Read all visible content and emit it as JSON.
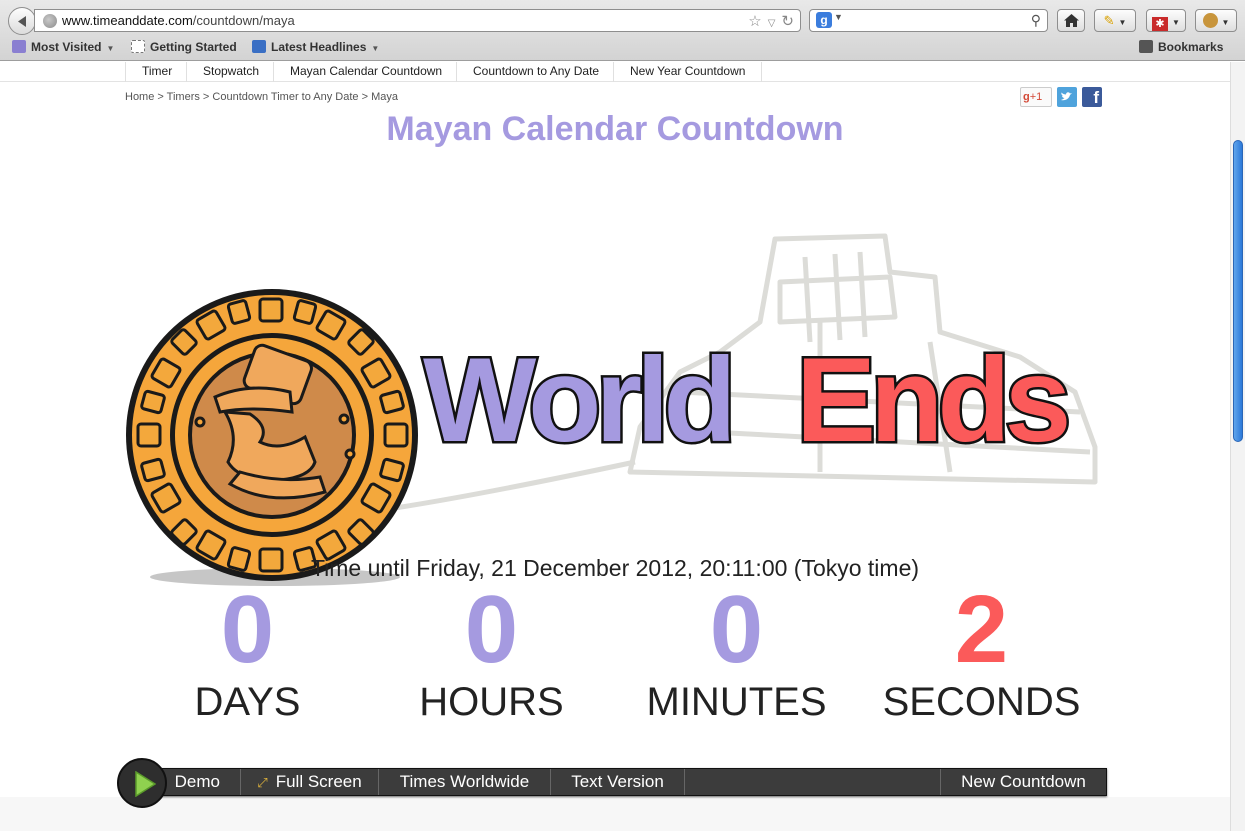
{
  "browser": {
    "url_host": "www.timeanddate.com",
    "url_path": "/countdown/maya",
    "bookmarks": [
      {
        "label": "Most Visited",
        "has_menu": true
      },
      {
        "label": "Getting Started",
        "has_menu": false
      },
      {
        "label": "Latest Headlines",
        "has_menu": true
      }
    ],
    "bookmarks_menu": "Bookmarks"
  },
  "nav": {
    "items": [
      "Timer",
      "Stopwatch",
      "Mayan Calendar Countdown",
      "Countdown to Any Date",
      "New Year Countdown"
    ]
  },
  "breadcrumb": "Home > Timers > Countdown Timer to Any Date > Maya",
  "share": {
    "gplus": "+1"
  },
  "page_title": "Mayan Calendar Countdown",
  "hero": {
    "word1": "World",
    "word2": "Ends"
  },
  "countdown": {
    "until_text": "Time until Friday, 21 December 2012, 20:11:00 (Tokyo time)",
    "units": [
      {
        "value": "0",
        "label": "DAYS"
      },
      {
        "value": "0",
        "label": "HOURS"
      },
      {
        "value": "0",
        "label": "MINUTES"
      },
      {
        "value": "2",
        "label": "SECONDS"
      }
    ]
  },
  "controls": {
    "demo": "Demo",
    "full_screen": "Full Screen",
    "times_worldwide": "Times Worldwide",
    "text_version": "Text Version",
    "new_countdown": "New Countdown"
  },
  "colors": {
    "purple": "#a59ae0",
    "red": "#fb5a5a",
    "medallion_orange": "#f2a43a"
  }
}
